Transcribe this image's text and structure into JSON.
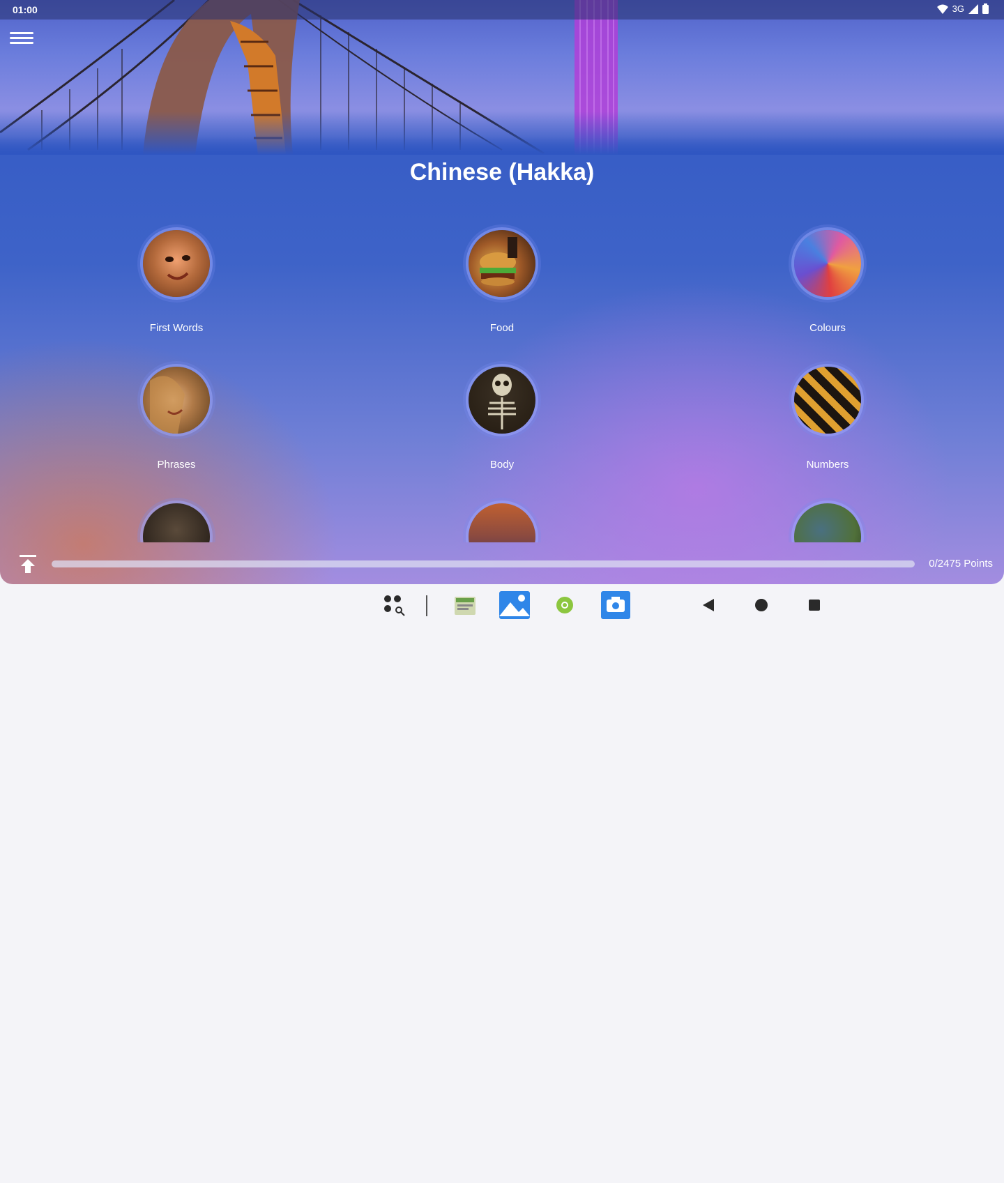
{
  "status_bar": {
    "time": "01:00",
    "network": "3G"
  },
  "header": {
    "title": "Chinese (Hakka)"
  },
  "categories": [
    {
      "label": "First Words",
      "icon": "child-face-icon",
      "c1": "#f0a070",
      "c2": "#6a3518"
    },
    {
      "label": "Food",
      "icon": "burger-icon",
      "c1": "#e3b050",
      "c2": "#5a2c10"
    },
    {
      "label": "Colours",
      "icon": "color-powder-icon",
      "c1": "#e05aa0",
      "c2": "#6a4fd0"
    },
    {
      "label": "Phrases",
      "icon": "smiling-woman-icon",
      "c1": "#d9a46a",
      "c2": "#5a3a1a"
    },
    {
      "label": "Body",
      "icon": "skeleton-icon",
      "c1": "#d8d0b8",
      "c2": "#231a10"
    },
    {
      "label": "Numbers",
      "icon": "numbers-icon",
      "c1": "#e0a030",
      "c2": "#1c1510"
    },
    {
      "label": "",
      "icon": "animal-icon",
      "c1": "#5a4a3a",
      "c2": "#1a1410"
    },
    {
      "label": "",
      "icon": "place-icon",
      "c1": "#c06030",
      "c2": "#3a2a60"
    },
    {
      "label": "",
      "icon": "nature-icon",
      "c1": "#4a7080",
      "c2": "#50703a"
    }
  ],
  "progress": {
    "text": "0/2475 Points",
    "value": 0,
    "max": 2475
  },
  "colors": {
    "accent": "#2f56c2",
    "text": "#ffffff"
  }
}
